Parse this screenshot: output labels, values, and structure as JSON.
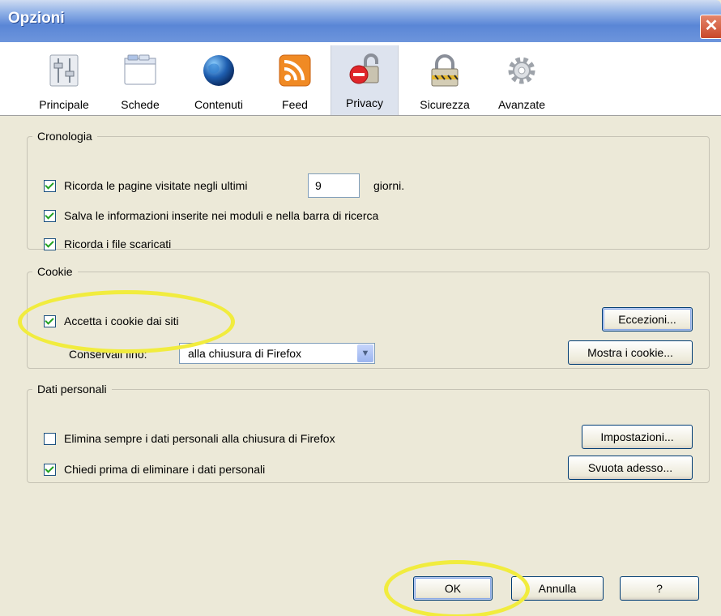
{
  "window": {
    "title": "Opzioni",
    "close_glyph": "✕"
  },
  "tabs": [
    {
      "label": "Principale",
      "icon": "sliders-icon"
    },
    {
      "label": "Schede",
      "icon": "tabs-window-icon"
    },
    {
      "label": "Contenuti",
      "icon": "globe-icon"
    },
    {
      "label": "Feed",
      "icon": "rss-feed-icon"
    },
    {
      "label": "Privacy",
      "icon": "privacy-lock-icon",
      "selected": true
    },
    {
      "label": "Sicurezza",
      "icon": "padlock-icon"
    },
    {
      "label": "Avanzate",
      "icon": "gear-icon"
    }
  ],
  "history": {
    "legend": "Cronologia",
    "remember_pages_label": "Ricorda le pagine visitate negli ultimi",
    "days_value": "9",
    "days_unit": "giorni.",
    "save_forms_label": "Salva le informazioni inserite nei moduli e nella barra di ricerca",
    "remember_downloads_label": "Ricorda i file scaricati"
  },
  "cookies": {
    "legend": "Cookie",
    "accept_label": "Accetta i cookie dai siti",
    "keep_until_label": "Conservali fino:",
    "keep_until_value": "alla chiusura di Firefox",
    "exceptions_button": "Eccezioni...",
    "show_cookies_button": "Mostra i cookie..."
  },
  "private_data": {
    "legend": "Dati personali",
    "always_clear_label": "Elimina sempre i dati personali alla chiusura di Firefox",
    "ask_before_label": "Chiedi prima di eliminare i dati personali",
    "settings_button": "Impostazioni...",
    "clear_now_button": "Svuota adesso..."
  },
  "footer": {
    "ok": "OK",
    "cancel": "Annulla",
    "help": "?"
  },
  "checkbox_state": {
    "remember_pages": true,
    "save_forms": true,
    "remember_downloads": true,
    "accept_cookies": true,
    "always_clear": false,
    "ask_before": true
  },
  "colors": {
    "titlebar_blue": "#5a86d6",
    "dialog_bg": "#ece9d8",
    "highlight_yellow": "#f1ec3e",
    "check_green": "#21a121"
  }
}
